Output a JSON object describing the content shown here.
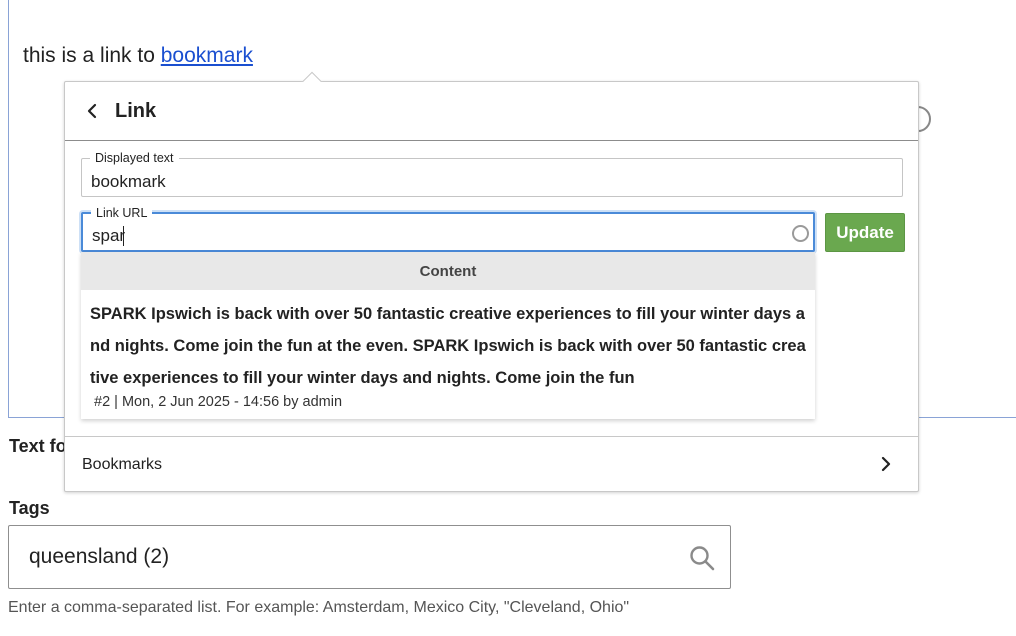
{
  "editor": {
    "text_before_link": "this is a link to ",
    "link_text": "bookmark"
  },
  "background": {
    "text_format_label": "Text fo",
    "tags": {
      "label": "Tags",
      "value": "queensland (2)",
      "description": "Enter a comma-separated list. For example: Amsterdam, Mexico City, \"Cleveland, Ohio\""
    }
  },
  "balloon": {
    "title": "Link",
    "displayed_text": {
      "legend": "Displayed text",
      "value": "bookmark"
    },
    "link_url": {
      "legend": "Link URL",
      "value": "spar"
    },
    "update_label": "Update",
    "autocomplete": {
      "group_header": "Content",
      "items": [
        {
          "title": "SPARK Ipswich is back with over 50 fantastic creative experiences to fill your winter days and nights. Come join the fun at the even. SPARK Ipswich is back with over 50 fantastic creative experiences to fill your winter days and nights. Come join the fun",
          "meta": "#2 | Mon, 2 Jun 2025 - 14:56 by admin"
        }
      ]
    },
    "bookmarks_label": "Bookmarks"
  },
  "colors": {
    "accent_focus": "#4a8ad8",
    "update_button": "#6aa84f",
    "link": "#1a4fd0"
  }
}
